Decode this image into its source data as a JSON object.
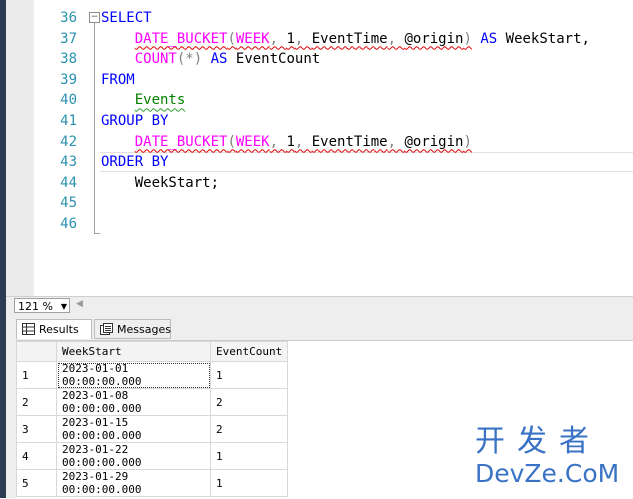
{
  "editor": {
    "line_numbers": [
      "36",
      "37",
      "38",
      "39",
      "40",
      "41",
      "42",
      "43",
      "44",
      "45",
      "46"
    ],
    "lines": [
      [
        {
          "t": "SELECT",
          "c": "kw"
        }
      ],
      [
        {
          "t": "    "
        },
        {
          "t": "DATE_BUCKET(WEEK, 1, EventTime, @origin)",
          "c": "mix1"
        },
        {
          "t": " AS ",
          "c": "kw"
        },
        {
          "t": "WeekStart,",
          "c": "var"
        }
      ],
      [
        {
          "t": "    "
        },
        {
          "t": "COUNT",
          "c": "fn"
        },
        {
          "t": "(*)",
          "c": "gr"
        },
        {
          "t": " AS ",
          "c": "kw"
        },
        {
          "t": "EventCount",
          "c": "var"
        }
      ],
      [
        {
          "t": "FROM",
          "c": "kw"
        }
      ],
      [
        {
          "t": "    "
        },
        {
          "t": "Events",
          "c": "ob-squig"
        }
      ],
      [
        {
          "t": "GROUP BY",
          "c": "kw"
        }
      ],
      [
        {
          "t": "    "
        },
        {
          "t": "DATE_BUCKET(WEEK, 1, EventTime, @origin)",
          "c": "mix1"
        }
      ],
      [
        {
          "t": "ORDER BY",
          "c": "kw"
        }
      ],
      [
        {
          "t": "    WeekStart;",
          "c": "var"
        }
      ],
      [],
      []
    ]
  },
  "status": {
    "zoom": "121 %"
  },
  "tabs": {
    "results": "Results",
    "messages": "Messages"
  },
  "grid": {
    "headers": [
      "",
      "WeekStart",
      "EventCount"
    ],
    "rows": [
      [
        "1",
        "2023-01-01 00:00:00.000",
        "1"
      ],
      [
        "2",
        "2023-01-08 00:00:00.000",
        "2"
      ],
      [
        "3",
        "2023-01-15 00:00:00.000",
        "2"
      ],
      [
        "4",
        "2023-01-22 00:00:00.000",
        "1"
      ],
      [
        "5",
        "2023-01-29 00:00:00.000",
        "1"
      ]
    ]
  },
  "watermark": {
    "top": "开发者",
    "bottom": "DevZe.CoM"
  },
  "colors": {
    "keyword": "#0000ff",
    "function": "#ff00ff",
    "object": "#008000",
    "line_number": "#2b91af"
  }
}
